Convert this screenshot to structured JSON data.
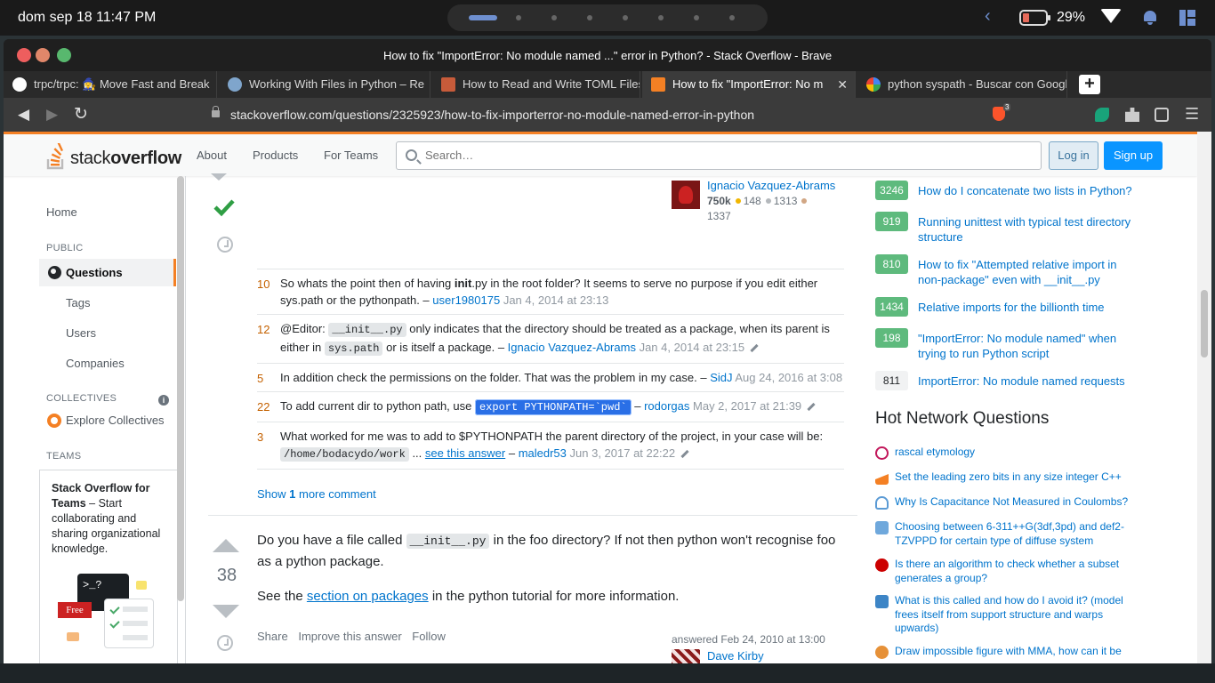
{
  "os": {
    "clock": "dom sep 18 11:47 PM",
    "battery_pct": "29%",
    "battery_level": 0.29
  },
  "window": {
    "title": "How to fix \"ImportError: No module named ...\" error in Python? - Stack Overflow - Brave"
  },
  "tabs": [
    {
      "label": "trpc/trpc: 🧙‍♀️ Move Fast and Break",
      "icon": "github-icon"
    },
    {
      "label": "Working With Files in Python – Re",
      "icon": "realpython-icon"
    },
    {
      "label": "How to Read and Write TOML Files",
      "icon": "article-icon"
    },
    {
      "label": "How to fix \"ImportError: No m",
      "icon": "stackoverflow-icon",
      "close": "✕"
    },
    {
      "label": "python syspath - Buscar con Googl",
      "icon": "google-icon"
    }
  ],
  "newtab_label": "+",
  "address": {
    "url": "stackoverflow.com/questions/2325923/how-to-fix-importerror-no-module-named-error-in-python",
    "shield_count": "3"
  },
  "so": {
    "logo_a": "stack",
    "logo_b": "overflow",
    "nav": [
      "About",
      "Products",
      "For Teams"
    ],
    "search_placeholder": "Search…",
    "login": "Log in",
    "signup": "Sign up",
    "brand_color": "#f48024"
  },
  "left_sidebar": {
    "home": "Home",
    "public_head": "PUBLIC",
    "questions": "Questions",
    "tags": "Tags",
    "users": "Users",
    "companies": "Companies",
    "collectives_head": "COLLECTIVES",
    "info": "i",
    "explore_collectives": "Explore Collectives",
    "teams_head": "TEAMS",
    "teams_title": "Stack Overflow for Teams",
    "teams_desc": " – Start collaborating and sharing organizational knowledge.",
    "free_badge": "Free",
    "terminal_text": ">_?"
  },
  "accepted_answer_user": {
    "name": "Ignacio Vazquez-Abrams",
    "rep": "750k",
    "gold": "148",
    "silver": "1313",
    "bronze": "1337"
  },
  "comments": [
    {
      "score": "10",
      "text_a": "So whats the point then of having ",
      "bold": "init",
      "text_b": ".py in the root folder? It seems to serve no purpose if you edit either sys.path or the pythonpath. – ",
      "user": "user1980175",
      "date": "Jan 4, 2014 at 23:13"
    },
    {
      "score": "12",
      "text_a": "@Editor: ",
      "code1": "__init__.py",
      "text_b": " only indicates that the directory should be treated as a package, when its parent is either in ",
      "code2": "sys.path",
      "text_c": " or is itself a package. – ",
      "user": "Ignacio Vazquez-Abrams",
      "date": "Jan 4, 2014 at 23:15"
    },
    {
      "score": "5",
      "text_a": "In addition check the permissions on the folder. That was the problem in my case. – ",
      "user": "SidJ",
      "date": "Aug 24, 2016 at 3:08"
    },
    {
      "score": "22",
      "text_a": "To add current dir to python path, use ",
      "code1": "export PYTHONPATH=`pwd`",
      "text_b": " – ",
      "user": "rodorgas",
      "date": "May 2, 2017 at 21:39"
    },
    {
      "score": "3",
      "text_a": "What worked for me was to add to $PYTHONPATH the parent directory of the project, in your case will be: ",
      "code1": "/home/bodacydo/work",
      "text_b": " ... ",
      "link": "see this answer",
      "text_c": " – ",
      "user": "maledr53",
      "date": "Jun 3, 2017 at 22:22"
    }
  ],
  "show_more": {
    "a": "Show ",
    "count": "1",
    "b": " more comment"
  },
  "answer": {
    "score": "38",
    "p1_a": "Do you have a file called ",
    "p1_code": "__init__.py",
    "p1_b": " in the foo directory? If not then python won't recognise foo as a python package.",
    "p2_a": "See the ",
    "p2_link": "section on packages",
    "p2_b": " in the python tutorial for more information.",
    "share": "Share",
    "improve": "Improve this answer",
    "follow": "Follow",
    "answered": "answered Feb 24, 2010 at 13:00",
    "user": "Dave Kirby"
  },
  "linked": [
    {
      "score": "3246",
      "title": "How do I concatenate two lists in Python?",
      "accepted": true
    },
    {
      "score": "919",
      "title": "Running unittest with typical test directory structure",
      "accepted": true
    },
    {
      "score": "810",
      "title": "How to fix \"Attempted relative import in non-package\" even with __init__.py",
      "accepted": true
    },
    {
      "score": "1434",
      "title": "Relative imports for the billionth time",
      "accepted": true
    },
    {
      "score": "198",
      "title": "\"ImportError: No module named\" when trying to run Python script",
      "accepted": true
    },
    {
      "score": "811",
      "title": "ImportError: No module named requests",
      "accepted": false
    }
  ],
  "hot_network": {
    "title": "Hot Network Questions",
    "items": [
      {
        "title": "rascal etymology",
        "icon": "english-icon",
        "color": "#c2185b"
      },
      {
        "title": "Set the leading zero bits in any size integer C++",
        "icon": "codegolf-icon",
        "color": "#f48024"
      },
      {
        "title": "Why Is Capacitance Not Measured in Coulombs?",
        "icon": "physics-icon",
        "color": "#5b9bd5"
      },
      {
        "title": "Choosing between 6-311++G(3df,3pd) and def2-TZVPPD for certain type of diffuse system",
        "icon": "mattermodeling-icon",
        "color": "#6fa8dc"
      },
      {
        "title": "Is there an algorithm to check whether a subset generates a group?",
        "icon": "math-icon",
        "color": "#cc0000"
      },
      {
        "title": "What is this called and how do I avoid it? (model frees itself from support structure and warps upwards)",
        "icon": "3dprinting-icon",
        "color": "#3d85c6"
      },
      {
        "title": "Draw impossible figure with MMA, how can it be",
        "icon": "mathematica-icon",
        "color": "#e69138"
      }
    ]
  }
}
